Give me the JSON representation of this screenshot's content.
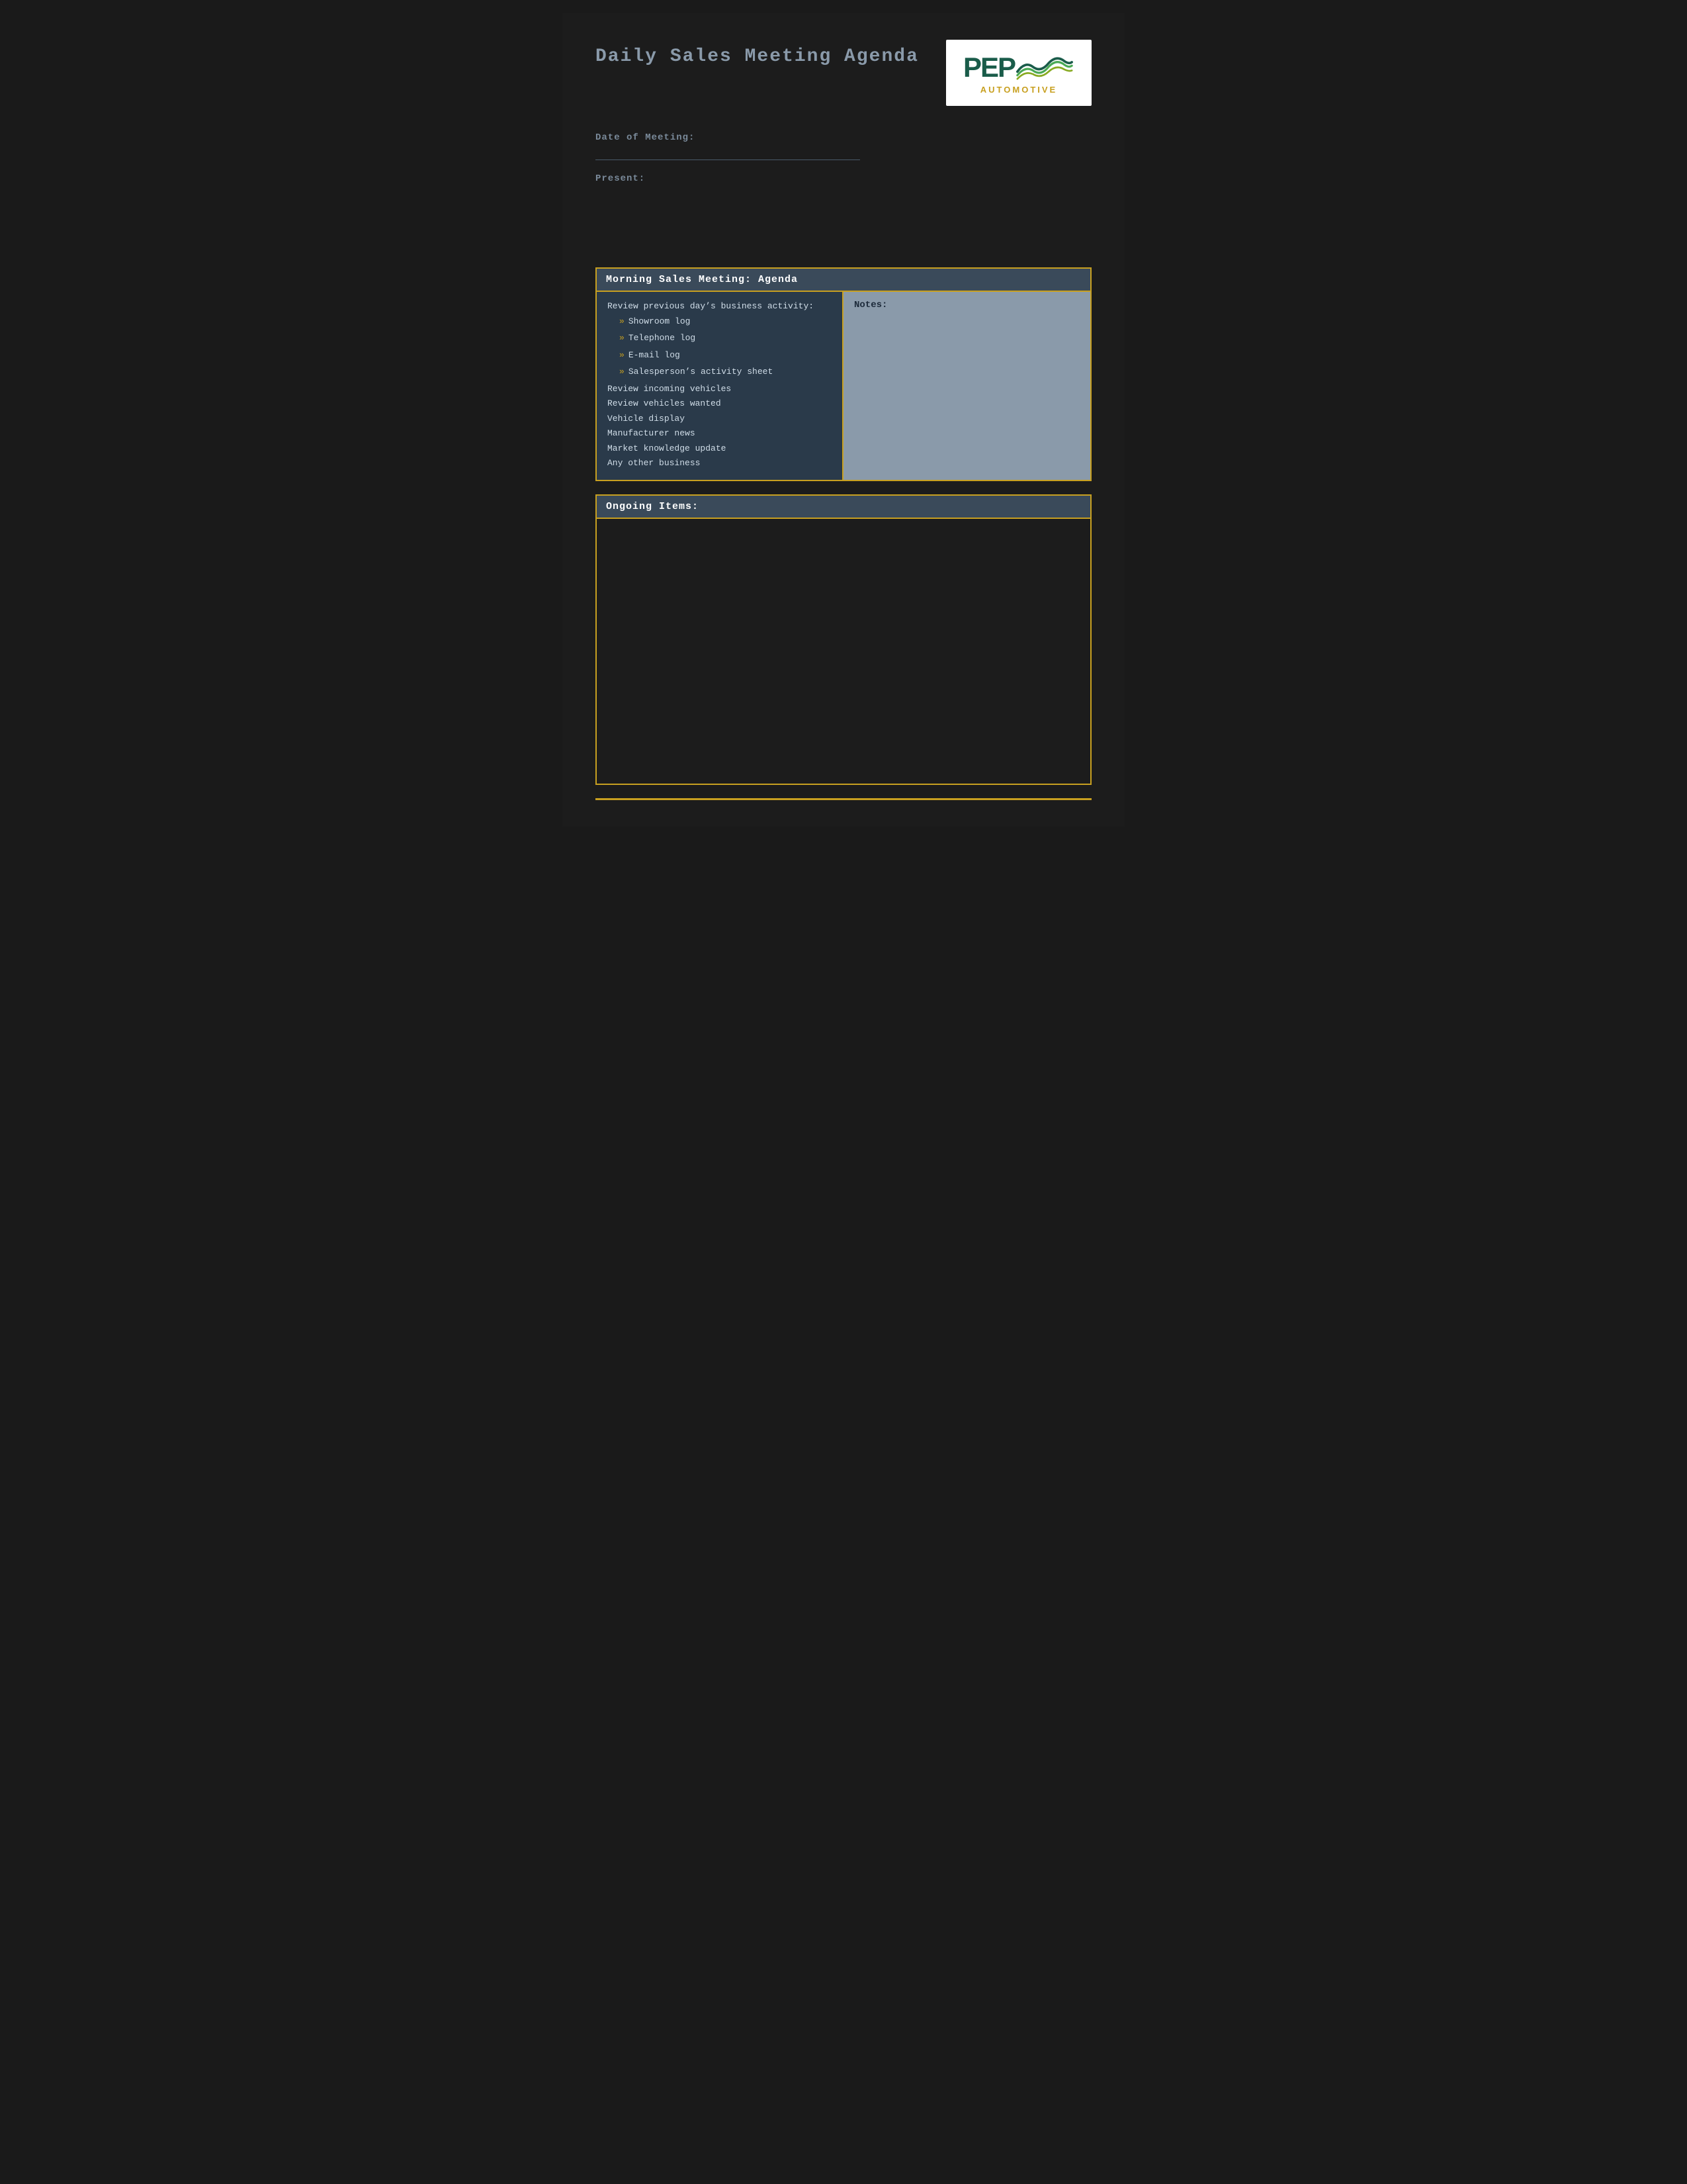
{
  "page": {
    "title": "Daily Sales Meeting Agenda",
    "background_color": "#1c1c1c"
  },
  "header": {
    "title": "Daily Sales Meeting Agenda",
    "logo": {
      "pep_text": "PEP",
      "automotive_text": "AUTOMOTIVE"
    }
  },
  "meta": {
    "date_label": "Date of Meeting:",
    "present_label": "Present:"
  },
  "morning_section": {
    "header": "Morning Sales Meeting: Agenda",
    "agenda_title": "Review previous day’s business activity:",
    "sub_items": [
      "Showroom log",
      "Telephone log",
      "E-mail log",
      "Salesperson’s activity sheet"
    ],
    "additional_items": [
      "Review incoming vehicles",
      "Review vehicles wanted",
      "Vehicle display",
      "Manufacturer news",
      "Market knowledge update",
      "Any other business"
    ],
    "notes_label": "Notes:"
  },
  "ongoing_section": {
    "header": "Ongoing Items:"
  }
}
